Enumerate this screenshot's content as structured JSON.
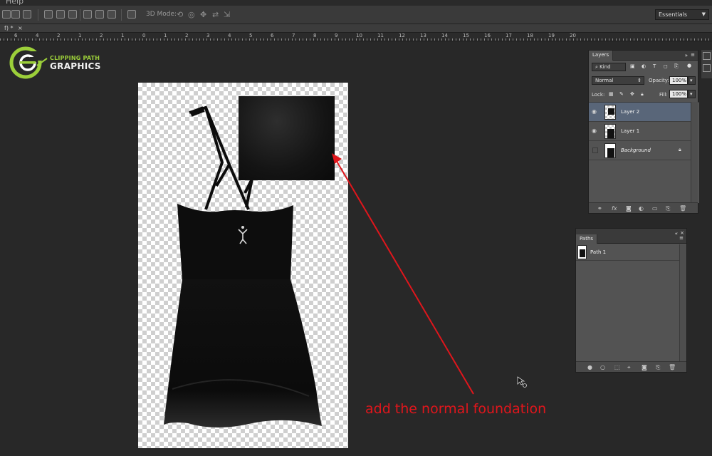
{
  "menubar": {
    "help_label": "Help"
  },
  "options_bar": {
    "mode_label": "3D Mode:",
    "workspace": "Essentials"
  },
  "document_tab": {
    "title": "f) *",
    "close": "×"
  },
  "ruler": {
    "labels": [
      "6",
      "4",
      "2",
      "1",
      "2",
      "1",
      "0",
      "1",
      "2",
      "3",
      "4",
      "5",
      "6",
      "7",
      "8",
      "9",
      "10",
      "11",
      "12",
      "13",
      "14",
      "15",
      "16",
      "17",
      "18",
      "19",
      "20"
    ]
  },
  "logo": {
    "line1": "CLIPPING PATH",
    "line2": "GRAPHICS"
  },
  "annotation": {
    "caption": "add the normal foundation",
    "color": "#e0161c"
  },
  "layers_panel": {
    "title": "Layers",
    "filter_label": "Kind",
    "blend_mode": "Normal",
    "opacity_label": "Opacity:",
    "opacity_value": "100%",
    "lock_label": "Lock:",
    "fill_label": "Fill:",
    "fill_value": "100%",
    "layers": [
      {
        "name": "Layer 2",
        "selected": true,
        "visible": true
      },
      {
        "name": "Layer 1",
        "selected": false,
        "visible": true
      },
      {
        "name": "Background",
        "selected": false,
        "visible": false
      }
    ]
  },
  "paths_panel": {
    "title": "Paths",
    "paths": [
      {
        "name": "Path 1"
      }
    ]
  },
  "colors": {
    "selection": "#596679",
    "logo_green": "#9ccf3a",
    "canvas_bg": "#282828"
  }
}
